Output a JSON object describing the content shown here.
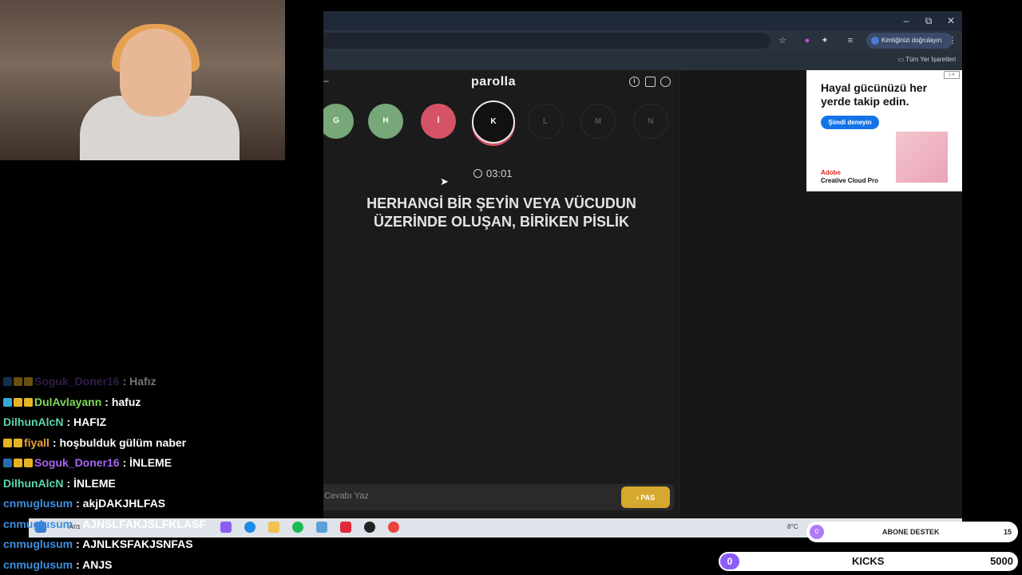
{
  "browser": {
    "profile_chip": "Kimliğinizi doğrulayın",
    "all_bookmarks": "Tüm Yer İşaretleri",
    "window_controls": {
      "minimize": "–",
      "restore": "⧉",
      "close": "✕"
    }
  },
  "game": {
    "title": "parolla",
    "letters": [
      {
        "letter": "G",
        "state": "done"
      },
      {
        "letter": "H",
        "state": "done"
      },
      {
        "letter": "İ",
        "state": "wrong"
      },
      {
        "letter": "K",
        "state": "active"
      },
      {
        "letter": "L",
        "state": "pending"
      },
      {
        "letter": "M",
        "state": "pending"
      },
      {
        "letter": "N",
        "state": "pending"
      }
    ],
    "timer": "03:01",
    "question": "HERHANGİ BİR ŞEYİN VEYA VÜCUDUN ÜZERİNDE OLUŞAN, BİRİKEN PİSLİK",
    "answer_placeholder": "Cevabı Yaz",
    "pass_label": "› PAS"
  },
  "ad": {
    "headline": "Hayal gücünüzü her yerde takip edin.",
    "cta": "Şimdi deneyin",
    "brand_line1": "Adobe",
    "brand_line2": "Creative Cloud Pro"
  },
  "chat": [
    {
      "user": "Soguk_Doner16",
      "user_color": "#6b3fa0",
      "message": ": Hafız",
      "faded": true
    },
    {
      "user": "DulAvlayann",
      "user_color": "#7ed957",
      "message": ": hafuz",
      "faded": false
    },
    {
      "user": "DilhunAlcN",
      "user_color": "#5cd6a8",
      "message": ": HAFIZ",
      "faded": false
    },
    {
      "user": "fiyall",
      "user_color": "#e8a33a",
      "message": ": hoşbulduk gülüm naber",
      "faded": false
    },
    {
      "user": "Soguk_Doner16",
      "user_color": "#a466f0",
      "message": ": İNLEME",
      "faded": false
    },
    {
      "user": "DilhunAlcN",
      "user_color": "#5cd6a8",
      "message": ": İNLEME",
      "faded": false
    },
    {
      "user": "cnmuglusum",
      "user_color": "#3d8fe0",
      "message": ": akjDAKJHLFAS",
      "faded": false
    },
    {
      "user": "cnmuglusum",
      "user_color": "#3d8fe0",
      "message": ": AJNSLFAKJSLFKLASF",
      "faded": false
    },
    {
      "user": "cnmuglusum",
      "user_color": "#3d8fe0",
      "message": ": AJNLKSFAKJSNFAS",
      "faded": false
    },
    {
      "user": "cnmuglusum",
      "user_color": "#3d8fe0",
      "message": ": ANJS",
      "faded": false
    }
  ],
  "overlays": {
    "sub_label": "ABONE DESTEK",
    "sub_count": "15",
    "sub_progress": "0",
    "kicks_current": "0",
    "kicks_label": "KICKS",
    "kicks_goal": "5000"
  },
  "taskbar": {
    "search": "Ara",
    "weather": "8°C"
  },
  "colors": {
    "correct": "#76a87a",
    "wrong": "#d65265",
    "pass_button": "#d4a92e",
    "kicks_accent": "#8b5cf6"
  }
}
